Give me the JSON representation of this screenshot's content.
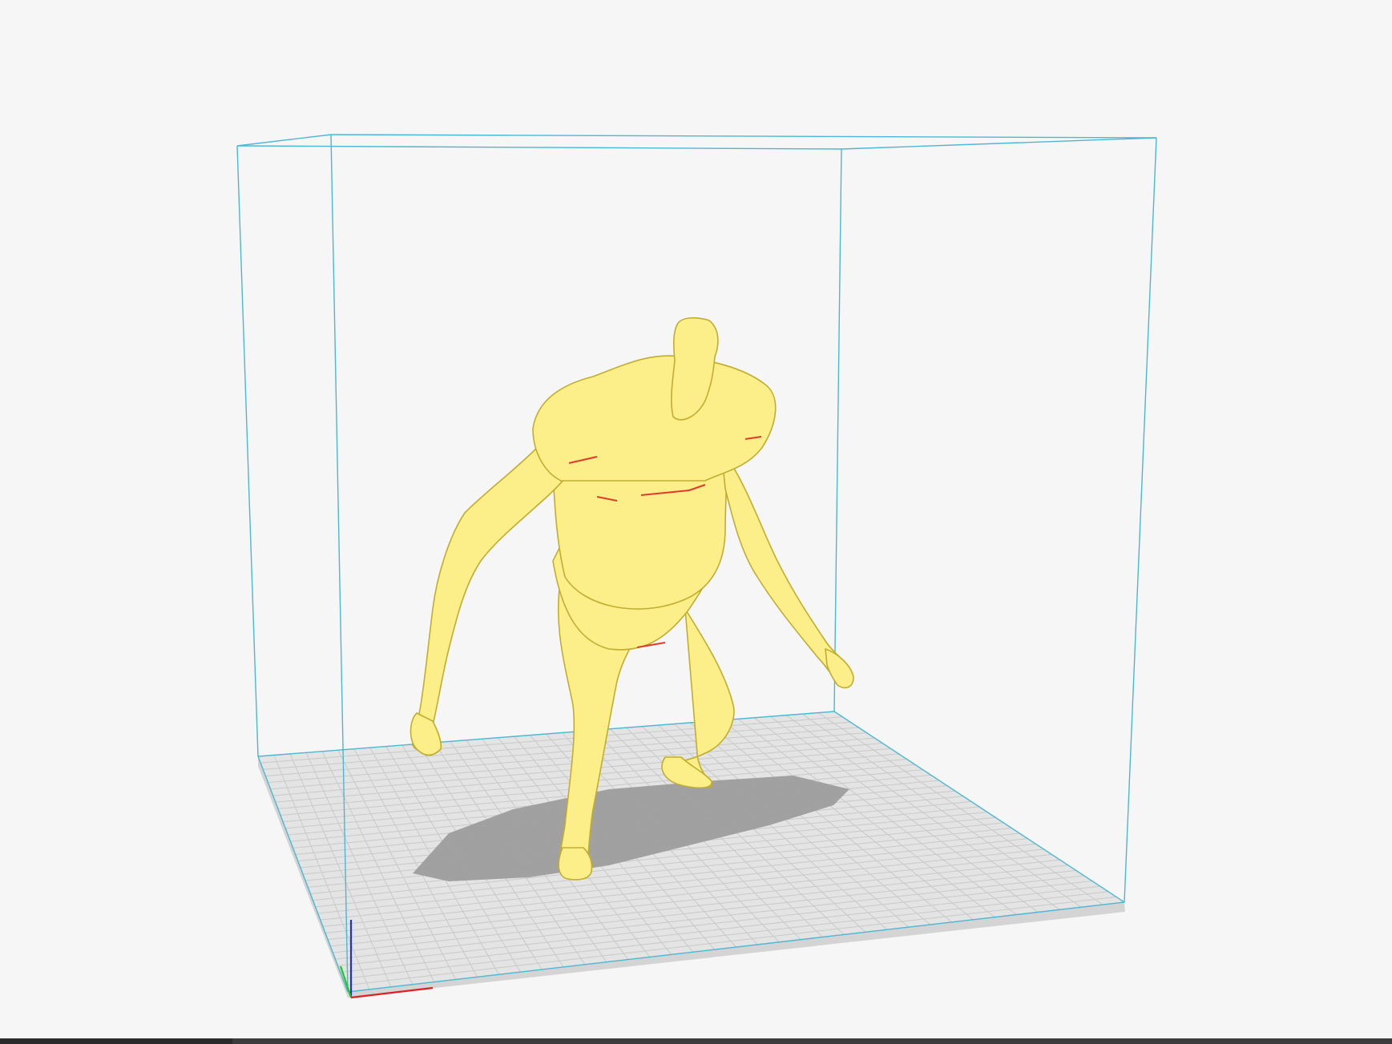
{
  "scene": {
    "description_visible": false,
    "colors": {
      "background": "#f6f6f6",
      "build_volume": "#46b4d2",
      "build_plate": "#e1e1e1",
      "plate_grid": "#c4c4c4",
      "plate_edge": "#cfcfcf",
      "model_fill": "#fff08a",
      "model_stroke": "#c9b536",
      "model_overhang": "#e23a2a",
      "shadow": "#9b9b9b",
      "axis_x": "#e02020",
      "axis_y": "#22c422",
      "axis_z": "#2030d8"
    },
    "axes": {
      "x_icon": "x-axis-indicator",
      "y_icon": "y-axis-indicator",
      "z_icon": "z-axis-indicator"
    }
  }
}
